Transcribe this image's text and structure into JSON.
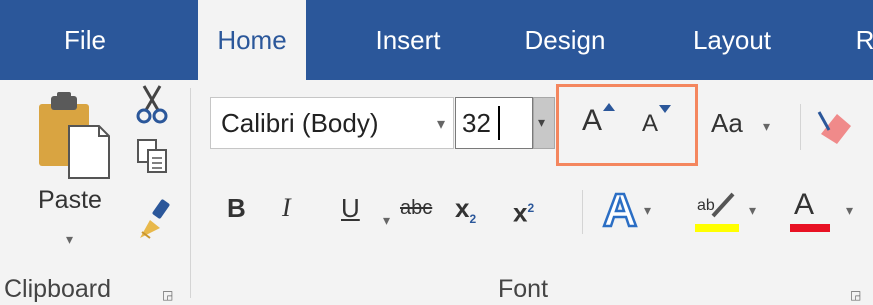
{
  "tabs": [
    {
      "label": "File",
      "active": false
    },
    {
      "label": "Home",
      "active": true
    },
    {
      "label": "Insert",
      "active": false
    },
    {
      "label": "Design",
      "active": false
    },
    {
      "label": "Layout",
      "active": false
    },
    {
      "label": "R",
      "active": false
    }
  ],
  "clipboard": {
    "paste_label": "Paste",
    "group_label": "Clipboard"
  },
  "font": {
    "font_name": "Calibri (Body)",
    "font_size": "32",
    "grow_font_label": "A",
    "shrink_font_label": "A",
    "change_case_label": "Aa",
    "bold_label": "B",
    "italic_label": "I",
    "underline_label": "U",
    "strikethrough_label": "abc",
    "subscript_label": "x",
    "subscript_mark": "2",
    "superscript_label": "x",
    "superscript_mark": "2",
    "font_color_label": "A",
    "group_label": "Font"
  },
  "colors": {
    "tab_bar": "#2b579a",
    "highlight_box": "#f4865e",
    "highlight_yellow": "#ffff00",
    "font_color_red": "#e81123"
  }
}
